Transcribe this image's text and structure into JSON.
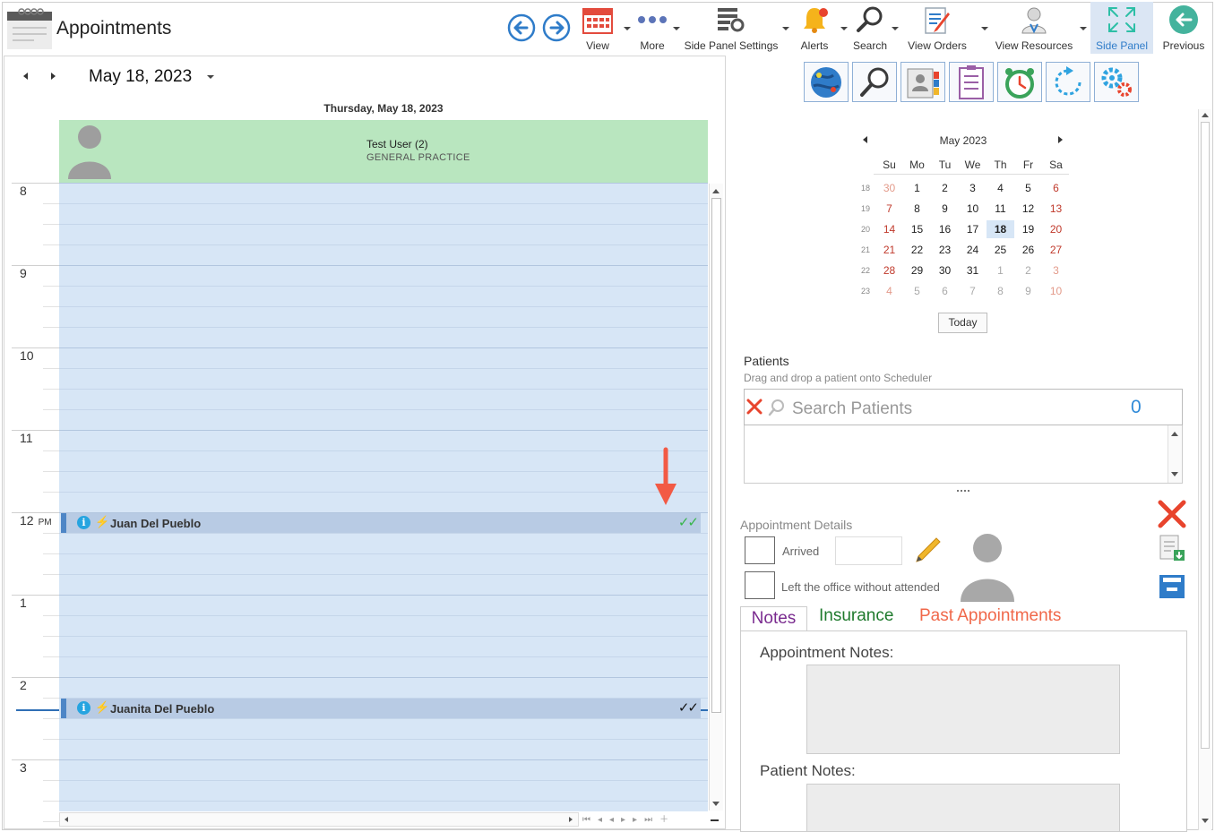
{
  "app": {
    "title": "Appointments"
  },
  "toolbar": {
    "view_label": "View",
    "more_label": "More",
    "side_panel_settings_label": "Side Panel Settings",
    "alerts_label": "Alerts",
    "search_label": "Search",
    "view_orders_label": "View Orders",
    "view_resources_label": "View Resources",
    "side_panel_label": "Side Panel",
    "previous_label": "Previous"
  },
  "scheduler": {
    "date": "May 18, 2023",
    "day_header": "Thursday, May 18, 2023",
    "resource": {
      "name": "Test User (2)",
      "specialty": "GENERAL PRACTICE"
    },
    "hours": [
      {
        "label": "8",
        "ampm": ""
      },
      {
        "label": "9",
        "ampm": ""
      },
      {
        "label": "10",
        "ampm": ""
      },
      {
        "label": "11",
        "ampm": ""
      },
      {
        "label": "12",
        "ampm": "PM"
      },
      {
        "label": "1",
        "ampm": ""
      },
      {
        "label": "2",
        "ampm": ""
      },
      {
        "label": "3",
        "ampm": ""
      }
    ],
    "appointments": [
      {
        "patient": "Juan Del Pueblo",
        "time": "12:00 PM",
        "status_color": "#36b54a"
      },
      {
        "patient": "Juanita Del Pueblo",
        "time": "2:15 PM",
        "status_color": "#111111"
      }
    ]
  },
  "mini_calendar": {
    "month_label": "May 2023",
    "dow": [
      "Su",
      "Mo",
      "Tu",
      "We",
      "Th",
      "Fr",
      "Sa"
    ],
    "weeks": [
      {
        "wk": "18",
        "days": [
          "30",
          "1",
          "2",
          "3",
          "4",
          "5",
          "6"
        ]
      },
      {
        "wk": "19",
        "days": [
          "7",
          "8",
          "9",
          "10",
          "11",
          "12",
          "13"
        ]
      },
      {
        "wk": "20",
        "days": [
          "14",
          "15",
          "16",
          "17",
          "18",
          "19",
          "20"
        ]
      },
      {
        "wk": "21",
        "days": [
          "21",
          "22",
          "23",
          "24",
          "25",
          "26",
          "27"
        ]
      },
      {
        "wk": "22",
        "days": [
          "28",
          "29",
          "30",
          "31",
          "1",
          "2",
          "3"
        ]
      },
      {
        "wk": "23",
        "days": [
          "4",
          "5",
          "6",
          "7",
          "8",
          "9",
          "10"
        ]
      }
    ],
    "selected_day": "18",
    "today_label": "Today"
  },
  "patients": {
    "label": "Patients",
    "hint": "Drag and drop a patient onto Scheduler",
    "search_placeholder": "Search Patients",
    "count": "0"
  },
  "appointment_details": {
    "label": "Appointment Details",
    "arrived_label": "Arrived",
    "left_label": "Left the office without attended"
  },
  "tabs": {
    "notes": "Notes",
    "insurance": "Insurance",
    "past": "Past Appointments"
  },
  "notes": {
    "appointment_notes_label": "Appointment Notes:",
    "patient_notes_label": "Patient Notes:"
  },
  "colors": {
    "accent": "#2f8ad8",
    "resource_header": "#b9e6bf",
    "grid": "#d7e6f6",
    "appointment": "#b8cbe4",
    "annotation_arrow": "#f25a45"
  }
}
